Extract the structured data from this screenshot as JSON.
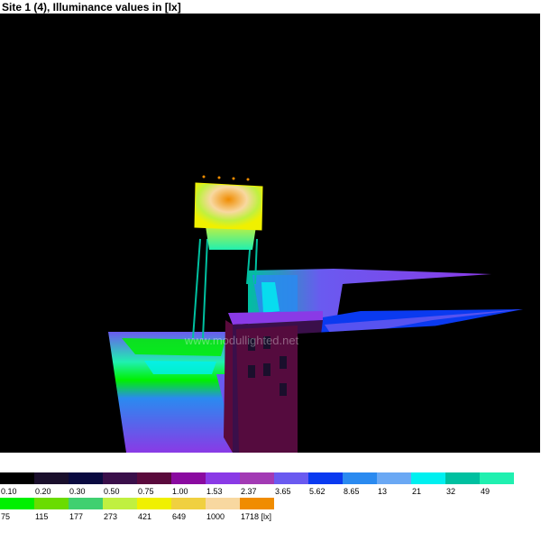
{
  "header": {
    "title": "Site 1 (4), Illuminance values in [lx]"
  },
  "scene": {
    "watermark": "www.modullighted.net",
    "background": "#000000"
  },
  "legend": {
    "row1": [
      {
        "label": "0.10",
        "color": "#000000"
      },
      {
        "label": "0.20",
        "color": "#1a0f2c"
      },
      {
        "label": "0.30",
        "color": "#0a0a40"
      },
      {
        "label": "0.50",
        "color": "#3a0f4a"
      },
      {
        "label": "0.75",
        "color": "#5a0a3c"
      },
      {
        "label": "1.00",
        "color": "#8a0aa0"
      },
      {
        "label": "1.53",
        "color": "#8a3ae6"
      },
      {
        "label": "2.37",
        "color": "#a23ab4"
      },
      {
        "label": "3.65",
        "color": "#6a5af0"
      },
      {
        "label": "5.62",
        "color": "#0a3af0"
      },
      {
        "label": "8.65",
        "color": "#2a8af0"
      },
      {
        "label": "13",
        "color": "#6aa8f4"
      },
      {
        "label": "21",
        "color": "#00f0f0"
      },
      {
        "label": "32",
        "color": "#00c0a0"
      },
      {
        "label": "49",
        "color": "#20f0b0"
      }
    ],
    "row2": [
      {
        "label": "75",
        "color": "#00f000"
      },
      {
        "label": "115",
        "color": "#6adc00"
      },
      {
        "label": "177",
        "color": "#40d070"
      },
      {
        "label": "273",
        "color": "#c0f040"
      },
      {
        "label": "421",
        "color": "#f0f000"
      },
      {
        "label": "649",
        "color": "#f0d040"
      },
      {
        "label": "1000",
        "color": "#f8d8a0"
      },
      {
        "label": "1718 [lx]",
        "color": "#f08c00"
      }
    ]
  }
}
